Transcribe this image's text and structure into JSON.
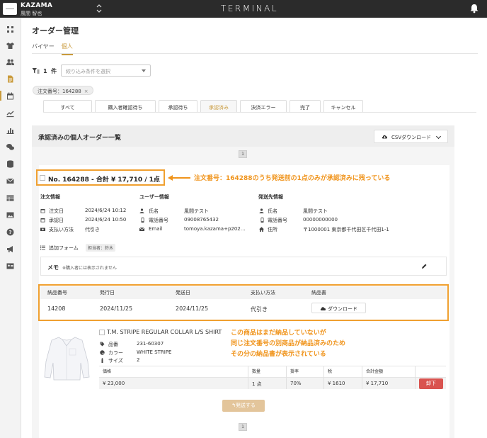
{
  "header": {
    "company": "KAZAMA",
    "user": "風間 智也",
    "brand": "TERMINAL"
  },
  "sidebar": {
    "icons": [
      "grid-icon",
      "tshirt-icon",
      "users-icon",
      "document-icon",
      "calendar-icon",
      "chart-line-icon",
      "bar-chart-icon",
      "chat-icon",
      "database-icon",
      "mail-icon",
      "table-icon",
      "image-icon",
      "help-icon",
      "megaphone-icon",
      "id-card-icon"
    ],
    "active_index": 3
  },
  "page": {
    "title": "オーダー管理",
    "tabs": [
      {
        "label": "バイヤー",
        "active": false
      },
      {
        "label": "個人",
        "active": true
      }
    ]
  },
  "filter": {
    "count": "1",
    "count_unit": "件",
    "placeholder": "絞り込み条件を選択",
    "chip": "注文番号：164288",
    "chip_close": "×"
  },
  "status_tabs": [
    {
      "label": "すべて",
      "active": false
    },
    {
      "label": "購入者確認待ち",
      "active": false
    },
    {
      "label": "承認待ち",
      "active": false
    },
    {
      "label": "承認済み",
      "active": true
    },
    {
      "label": "決済エラー",
      "active": false
    },
    {
      "label": "完了",
      "active": false
    },
    {
      "label": "キャンセル",
      "active": false
    }
  ],
  "panel": {
    "title": "承認済みの個人オーダー一覧",
    "csv_button": "CSVダウンロード",
    "page": "1"
  },
  "order": {
    "number": "No. 164288 - 合計 ¥ 17,710 / 1点",
    "annotation": "注文番号：164288のうち発送前の1点のみが承認済みに残っている",
    "order_info": {
      "title": "注文情報",
      "rows": [
        {
          "label": "注文日",
          "value": "2024/6/24 10:12"
        },
        {
          "label": "承認日",
          "value": "2024/6/24 10:50"
        },
        {
          "label": "支払い方法",
          "value": "代引き"
        }
      ]
    },
    "user_info": {
      "title": "ユーザー情報",
      "rows": [
        {
          "label": "氏名",
          "value": "風間テスト"
        },
        {
          "label": "電話番号",
          "value": "09008765432"
        },
        {
          "label": "Email",
          "value": "tomoya.kazama+p202…"
        }
      ]
    },
    "ship_info": {
      "title": "発送先情報",
      "rows": [
        {
          "label": "氏名",
          "value": "風間テスト"
        },
        {
          "label": "電話番号",
          "value": "00000000000"
        },
        {
          "label": "住所",
          "value": "〒1000001 東京都千代田区千代田1-1"
        }
      ]
    },
    "add_form": "追加フォーム",
    "tanto": "担当者：鈴木",
    "memo_label": "メモ",
    "memo_note": "※購入者には表示されません",
    "delivery_table": {
      "headers": [
        "納品番号",
        "発行日",
        "発送日",
        "支払い方法",
        "納品書"
      ],
      "row": [
        "14208",
        "2024/11/25",
        "2024/11/25",
        "代引き"
      ],
      "download": "ダウンロード"
    },
    "product": {
      "name": "T.M. STRIPE REGULAR COLLAR L/S SHIRT",
      "attrs": [
        {
          "label": "品番",
          "value": "231-60307"
        },
        {
          "label": "カラー",
          "value": "WHITE STRIPE"
        },
        {
          "label": "サイズ",
          "value": "2"
        }
      ],
      "grid_headers": [
        "価格",
        "数量",
        "掛率",
        "税",
        "合計金額"
      ],
      "grid_values": [
        "¥ 23,000",
        "1 点",
        "70%",
        "¥ 1610",
        "¥ 17,710"
      ],
      "oroshi": "卸下"
    },
    "annotation2": [
      "この商品はまだ納品していないが",
      "同じ注文番号の別商品が納品済みのため",
      "その分の納品書が表示されている"
    ],
    "ship_button": "発送する"
  },
  "colors": {
    "accent": "#c99a3b",
    "annotation": "#f0941c",
    "danger": "#d9534f"
  }
}
